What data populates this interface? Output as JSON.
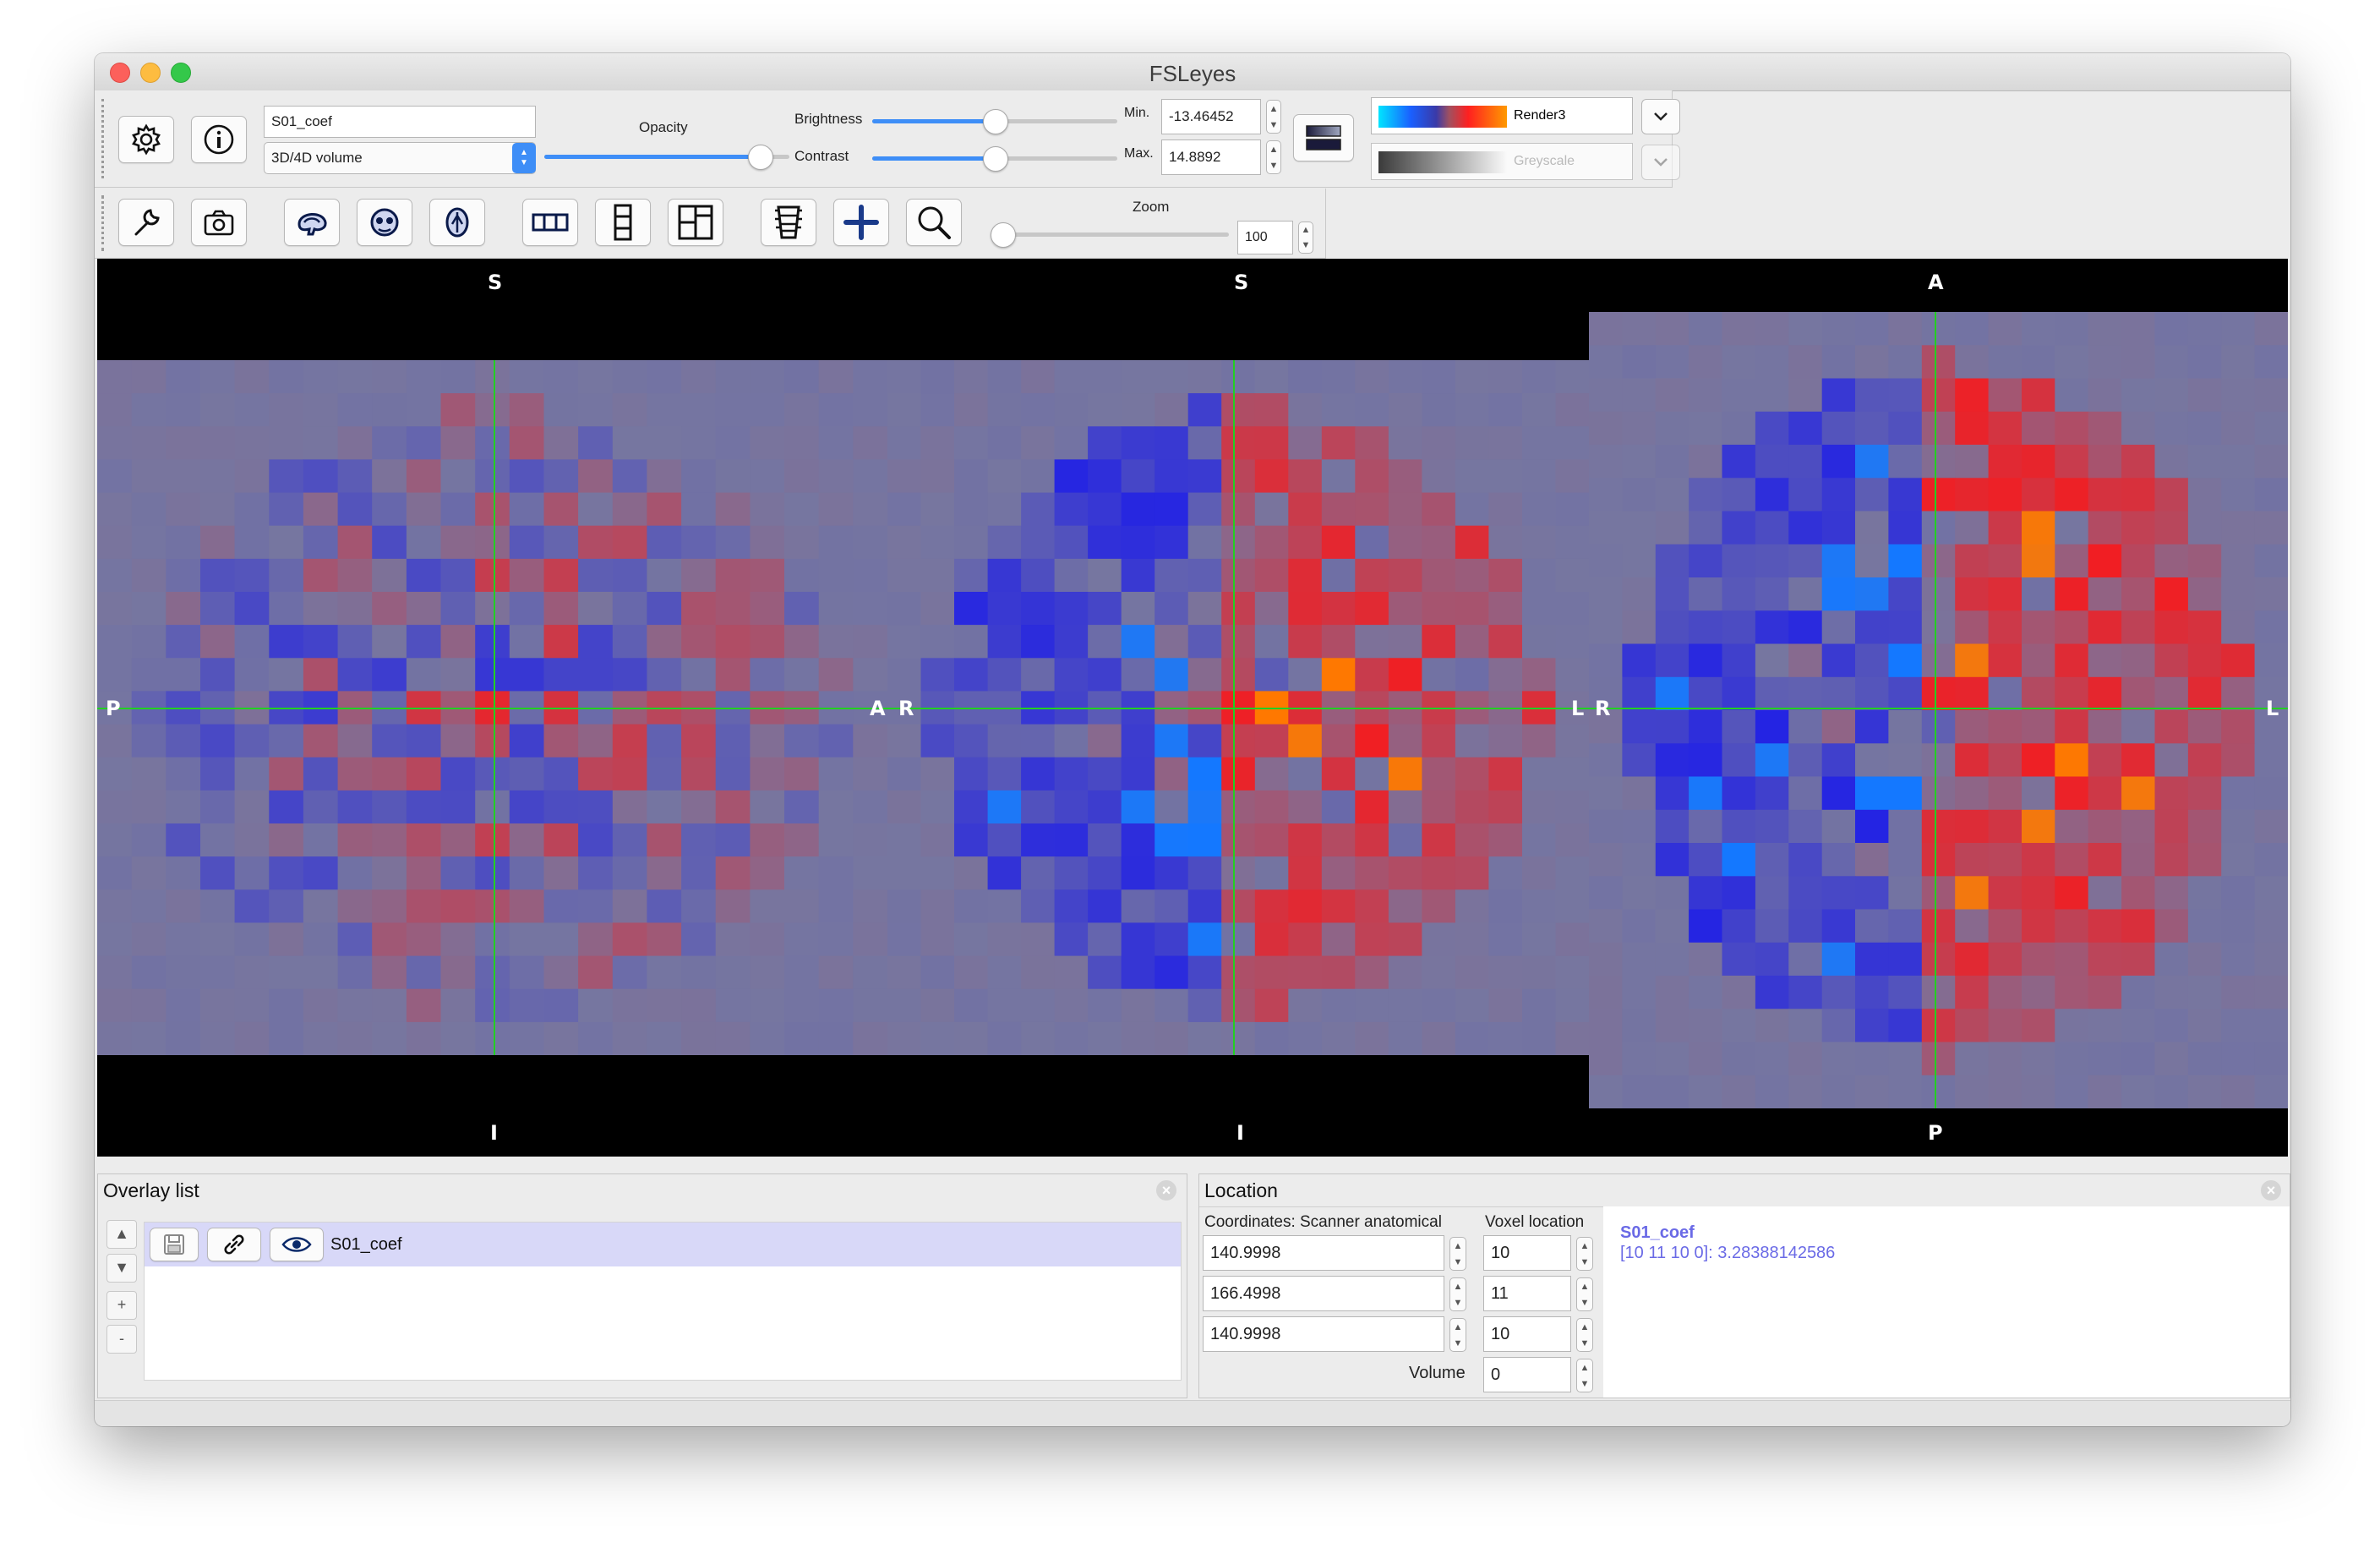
{
  "window": {
    "title": "FSLeyes"
  },
  "overlay_toolbar": {
    "overlay_name": "S01_coef",
    "overlay_type": "3D/4D volume",
    "opacity_label": "Opacity",
    "opacity_value": 0.88,
    "brightness_label": "Brightness",
    "brightness_value": 0.5,
    "contrast_label": "Contrast",
    "contrast_value": 0.5,
    "min_label": "Min.",
    "min_value": "-13.46452",
    "max_label": "Max.",
    "max_value": "14.8892",
    "colormap_primary": "Render3",
    "colormap_negative": "Greyscale"
  },
  "ortho_toolbar": {
    "zoom_label": "Zoom",
    "zoom_value": "100",
    "tools": [
      "wrench-icon",
      "camera-icon",
      "sagittal-icon",
      "coronal-icon",
      "axial-icon",
      "layout-horizontal-icon",
      "layout-vertical-icon",
      "layout-grid-icon",
      "movie-icon",
      "crosshair-icon",
      "zoom-icon"
    ]
  },
  "canvas": {
    "sagittal": {
      "top": "S",
      "bottom": "I",
      "left": "P",
      "right": "A"
    },
    "coronal": {
      "top": "S",
      "bottom": "I",
      "left": "R",
      "right": "L"
    },
    "axial": {
      "top": "A",
      "bottom": "P",
      "left": "R",
      "right": "L"
    },
    "crosshair_color": "#22d022"
  },
  "overlay_list": {
    "title": "Overlay list",
    "items": [
      {
        "name": "S01_coef",
        "visible": true
      }
    ],
    "up_label": "▲",
    "down_label": "▼",
    "add_label": "+",
    "remove_label": "-"
  },
  "location": {
    "title": "Location",
    "coords_label": "Coordinates: Scanner anatomical",
    "voxel_label": "Voxel location",
    "coords": [
      "140.9998",
      "166.4998",
      "140.9998"
    ],
    "voxels": [
      "10",
      "11",
      "10"
    ],
    "volume_label": "Volume",
    "volume_value": "0",
    "info_name": "S01_coef",
    "info_value": "[10 11 10 0]: 3.28388142586",
    "info_color": "#6a6ae6"
  }
}
